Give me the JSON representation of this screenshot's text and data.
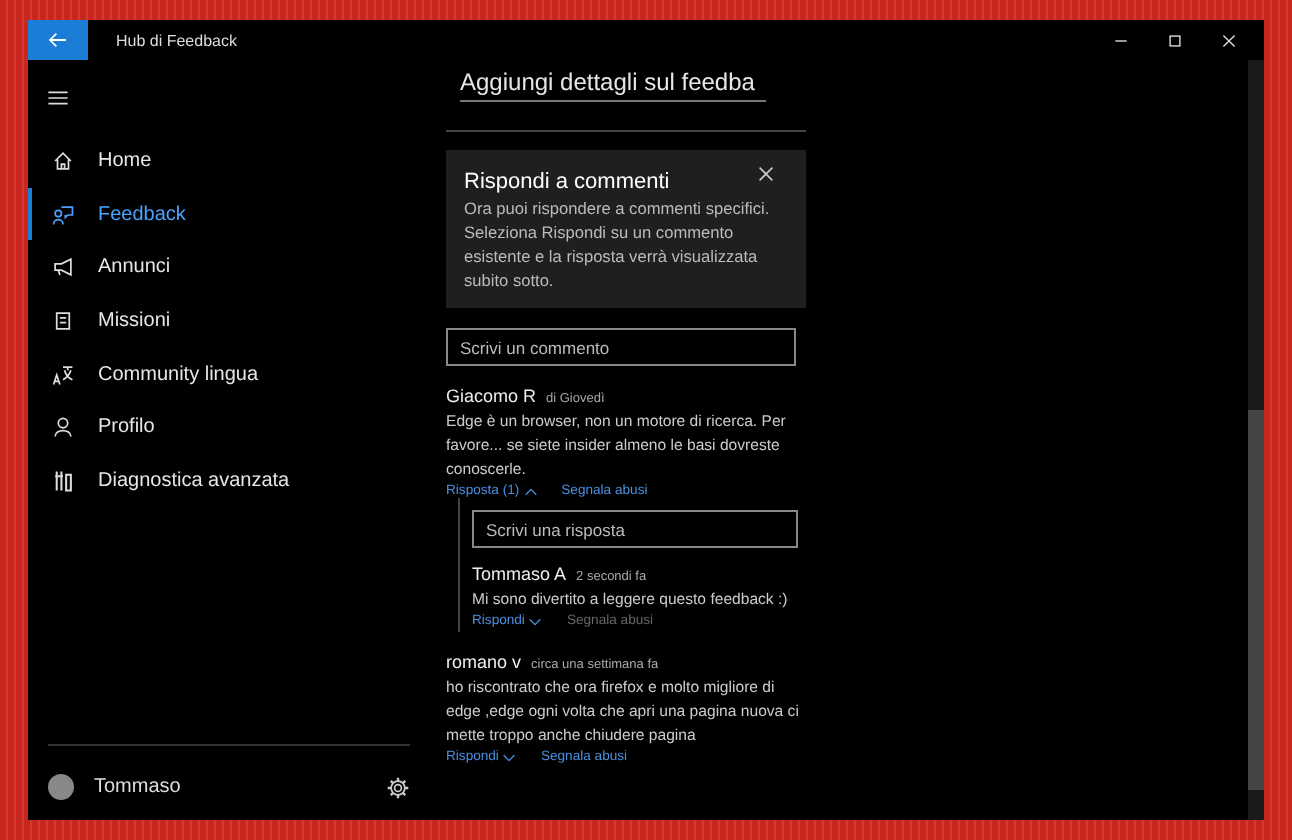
{
  "window": {
    "title": "Hub di Feedback"
  },
  "sidebar": {
    "items": [
      {
        "label": "Home",
        "selected": false
      },
      {
        "label": "Feedback",
        "selected": true
      },
      {
        "label": "Annunci",
        "selected": false
      },
      {
        "label": "Missioni",
        "selected": false
      },
      {
        "label": "Community lingua",
        "selected": false
      },
      {
        "label": "Profilo",
        "selected": false
      },
      {
        "label": "Diagnostica avanzata",
        "selected": false
      }
    ],
    "user": {
      "name": "Tommaso"
    }
  },
  "details_dropdown": {
    "label": "Aggiungi dettagli sul feedba"
  },
  "tip_card": {
    "title": "Rispondi a commenti",
    "text": "Ora puoi rispondere a commenti specifici. Seleziona Rispondi su un commento esistente e la risposta verrà visualizzata subito sotto."
  },
  "comment_field": {
    "placeholder": "Scrivi un commento"
  },
  "comments": [
    {
      "author": "Giacomo R",
      "time": "di Giovedì",
      "text": "Edge è un browser, non un motore di ricerca. Per favore... se siete insider almeno le basi dovreste conoscerle.",
      "reply_action": "Risposta (1)",
      "expanded": true,
      "report": "Segnala abusi",
      "report_disabled": false,
      "reply_field": {
        "placeholder": "Scrivi una risposta"
      },
      "children": [
        {
          "author": "Tommaso A",
          "time": "2 secondi fa",
          "text": "Mi sono divertito a leggere questo feedback :)",
          "reply_action": "Rispondi",
          "expanded": false,
          "report": "Segnala abusi",
          "report_disabled": true
        }
      ]
    },
    {
      "author": "romano v",
      "time": "circa una settimana fa",
      "text": "ho riscontrato che ora firefox e molto migliore di edge ,edge ogni volta che apri una pagina nuova ci mette troppo  anche chiudere pagina",
      "reply_action": "Rispondi",
      "expanded": false,
      "report": "Segnala abusi",
      "report_disabled": false
    }
  ]
}
